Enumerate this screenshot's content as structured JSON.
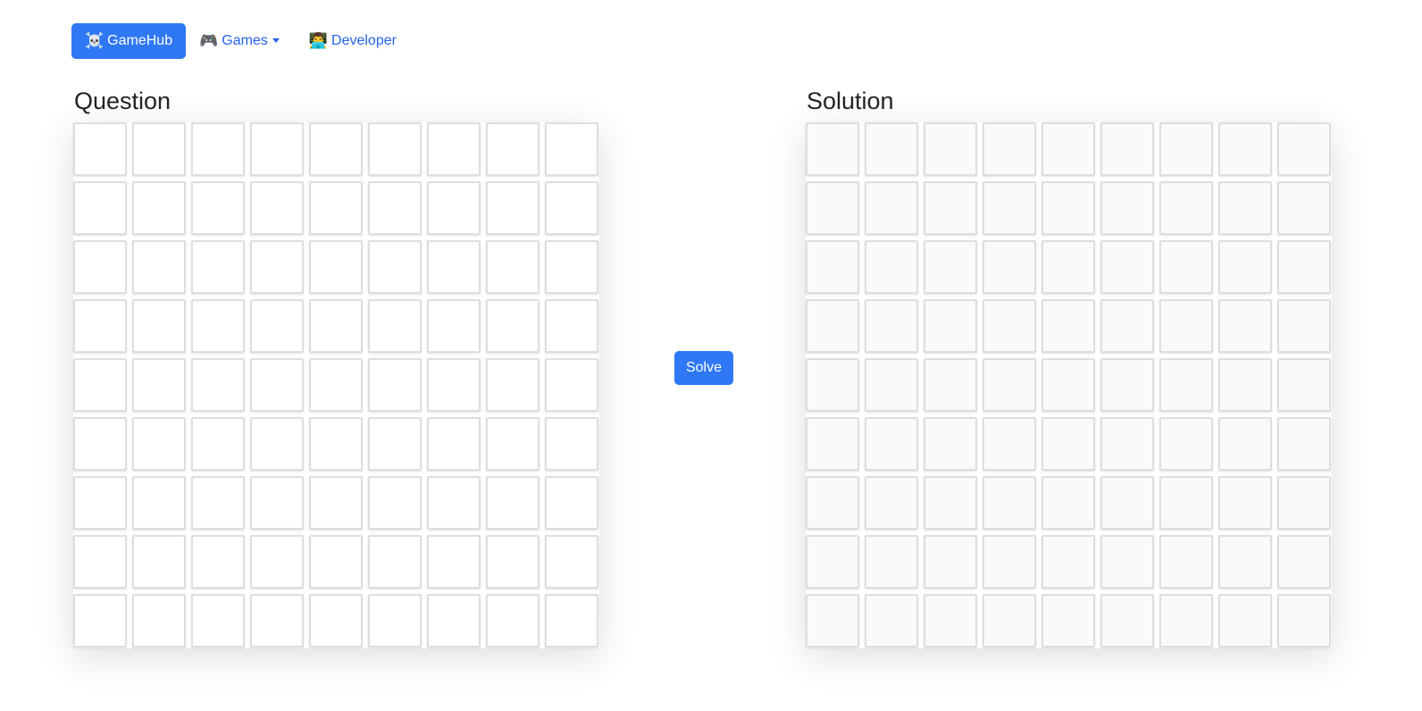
{
  "navbar": {
    "brand": {
      "icon": "☠️",
      "label": "GameHub"
    },
    "games": {
      "icon": "🎮",
      "label": "Games"
    },
    "developer": {
      "icon": "👨‍💻",
      "label": "Developer"
    }
  },
  "question": {
    "title": "Question",
    "cells": [
      [
        "",
        "",
        "",
        "",
        "",
        "",
        "",
        "",
        ""
      ],
      [
        "",
        "",
        "",
        "",
        "",
        "",
        "",
        "",
        ""
      ],
      [
        "",
        "",
        "",
        "",
        "",
        "",
        "",
        "",
        ""
      ],
      [
        "",
        "",
        "",
        "",
        "",
        "",
        "",
        "",
        ""
      ],
      [
        "",
        "",
        "",
        "",
        "",
        "",
        "",
        "",
        ""
      ],
      [
        "",
        "",
        "",
        "",
        "",
        "",
        "",
        "",
        ""
      ],
      [
        "",
        "",
        "",
        "",
        "",
        "",
        "",
        "",
        ""
      ],
      [
        "",
        "",
        "",
        "",
        "",
        "",
        "",
        "",
        ""
      ],
      [
        "",
        "",
        "",
        "",
        "",
        "",
        "",
        "",
        ""
      ]
    ]
  },
  "solve_button": {
    "label": "Solve"
  },
  "solution": {
    "title": "Solution",
    "cells": [
      [
        "",
        "",
        "",
        "",
        "",
        "",
        "",
        "",
        ""
      ],
      [
        "",
        "",
        "",
        "",
        "",
        "",
        "",
        "",
        ""
      ],
      [
        "",
        "",
        "",
        "",
        "",
        "",
        "",
        "",
        ""
      ],
      [
        "",
        "",
        "",
        "",
        "",
        "",
        "",
        "",
        ""
      ],
      [
        "",
        "",
        "",
        "",
        "",
        "",
        "",
        "",
        ""
      ],
      [
        "",
        "",
        "",
        "",
        "",
        "",
        "",
        "",
        ""
      ],
      [
        "",
        "",
        "",
        "",
        "",
        "",
        "",
        "",
        ""
      ],
      [
        "",
        "",
        "",
        "",
        "",
        "",
        "",
        "",
        ""
      ],
      [
        "",
        "",
        "",
        "",
        "",
        "",
        "",
        "",
        ""
      ]
    ]
  },
  "colors": {
    "primary": "#2f78f5",
    "link": "#2563eb",
    "cell_border": "#dedede"
  }
}
